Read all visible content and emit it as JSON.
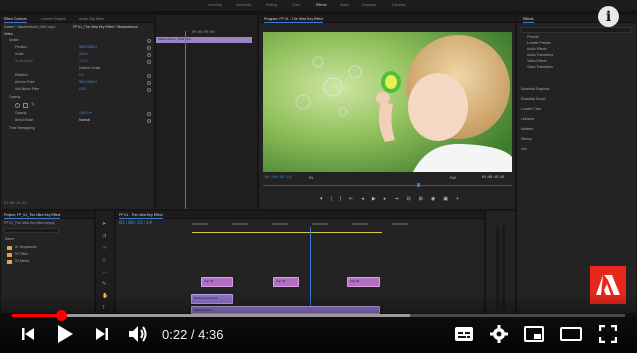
{
  "app": {
    "workspaces": [
      "Learning",
      "Assembly",
      "Editing",
      "Color",
      "Effects",
      "Audio",
      "Graphics",
      "Libraries"
    ],
    "active_workspace": "Effects"
  },
  "effect_controls": {
    "tabs": [
      "Effect Controls",
      "Lumetri Scopes",
      "Audio Clip Mixer",
      "Audio Clip Mixer: FP 01_The Ultra Key Effect"
    ],
    "breadcrumb": "Master * Maskedshoot_0002.mp4",
    "clip_label": "FP 01_The Ultra Key Effect * Maskedshoot",
    "section_video": "Video",
    "rows": [
      {
        "label": "Motion",
        "value": ""
      },
      {
        "label": "Position",
        "value": "960.0   540.0"
      },
      {
        "label": "Scale",
        "value": "100.0"
      },
      {
        "label": "Scale Width",
        "value": "100.0"
      },
      {
        "label": "",
        "value": "Uniform Scale"
      },
      {
        "label": "Rotation",
        "value": "0.0"
      },
      {
        "label": "Anchor Point",
        "value": "960.0   540.0"
      },
      {
        "label": "Anti-flicker Filter",
        "value": "0.00"
      },
      {
        "label": "Opacity",
        "value": ""
      },
      {
        "label": "Opacity",
        "value": "100.0 %"
      },
      {
        "label": "Blend Mode",
        "value": "Normal"
      },
      {
        "label": "Time Remapping",
        "value": ""
      }
    ],
    "mini_timecode": "00:00:00:00",
    "mini_clip": "Maskedshoot_0002.mp4",
    "footer_timecode": "01:00:15:14"
  },
  "program_monitor": {
    "title": "Program: FP 01 - The Ultra Key Effect",
    "timecode": "01:00:15:14",
    "fit": "Fit",
    "quality": "Full",
    "duration": "01:00:15:26"
  },
  "effects_panel": {
    "title": "Effects",
    "folders": [
      "Presets",
      "Lumetri Presets",
      "Audio Effects",
      "Audio Transitions",
      "Video Effects",
      "Video Transitions"
    ],
    "sections": [
      "Essential Graphics",
      "Essential Sound",
      "Lumetri Color",
      "Libraries",
      "Markers",
      "History",
      "Info"
    ]
  },
  "project": {
    "title": "Project: FP_01_The Ultra Key Effect",
    "subtitle": "FP 01_The Ultra Key effect.prproj",
    "column_name": "Name",
    "items": [
      "01 Sequences",
      "02 Titles",
      "03 Media"
    ]
  },
  "timeline": {
    "title": "FP 01 - The Ultra Key Effect",
    "timecode": "01:00:15:14",
    "ruler": [
      "01:00:00:00",
      "01:00:05:00",
      "01:00:10:00",
      "01:00:15:00",
      "01:00:20:00",
      "01:00:25:00"
    ],
    "clips": [
      {
        "label": "Clip 01",
        "track": 2
      },
      {
        "label": "Clip 02",
        "track": 2
      },
      {
        "label": "Clip 03",
        "track": 2
      },
      {
        "label": "Backgroundshoot",
        "track": 3
      },
      {
        "label": "Maskedshoot",
        "track": 4
      }
    ]
  },
  "player": {
    "current_time": "0:22",
    "duration": "4:36",
    "time_display": "0:22 / 4:36",
    "progress_played": 0.08,
    "progress_loaded": 0.65,
    "info_icon": "info-icon",
    "colors": {
      "played": "#ff0000",
      "accent_blue": "#4c8fe3",
      "clip_purple": "#b36fc4"
    }
  },
  "brand": {
    "logo_alt": "Adobe"
  }
}
